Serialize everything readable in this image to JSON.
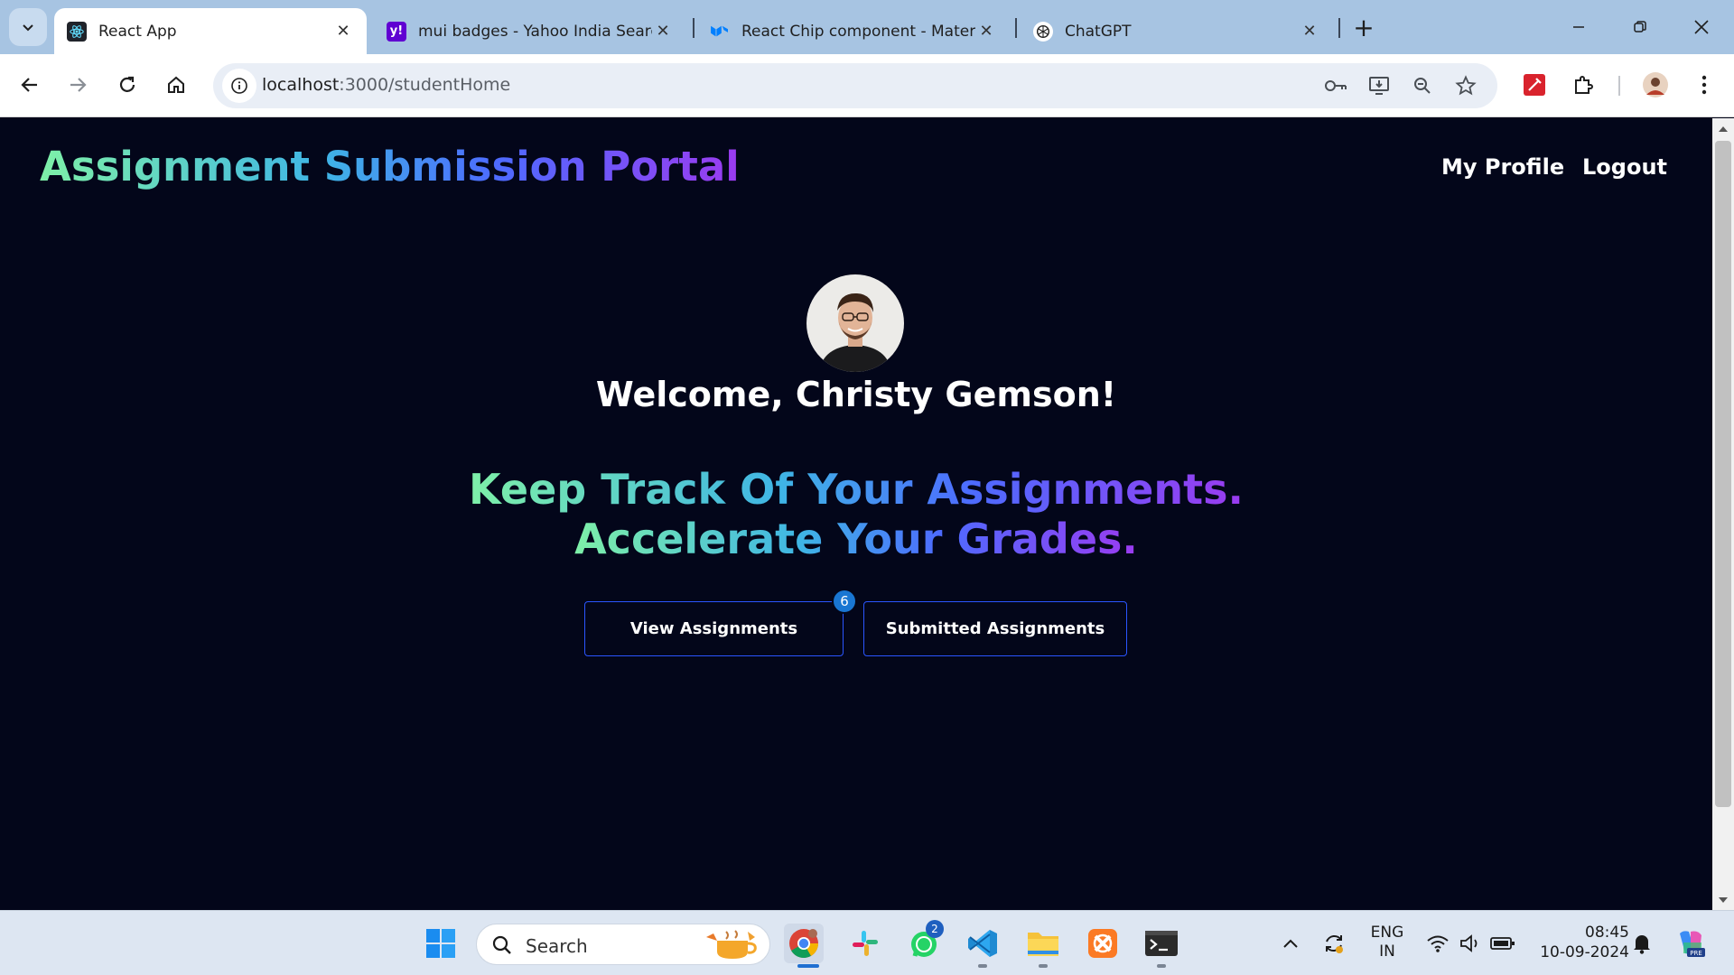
{
  "browser": {
    "tabs": [
      {
        "title": "React App",
        "active": true
      },
      {
        "title": "mui badges - Yahoo India Searc",
        "active": false
      },
      {
        "title": "React Chip component - Materi",
        "active": false
      },
      {
        "title": "ChatGPT",
        "active": false
      }
    ],
    "url_host": "localhost",
    "url_rest": ":3000/studentHome"
  },
  "page": {
    "brand": "Assignment Submission Portal",
    "nav": {
      "profile": "My Profile",
      "logout": "Logout"
    },
    "welcome": "Welcome, Christy Gemson!",
    "tagline_line1": "Keep Track Of Your Assignments.",
    "tagline_line2": "Accelerate Your Grades.",
    "buttons": {
      "view": "View Assignments",
      "submitted": "Submitted Assignments"
    },
    "badge_count": "6"
  },
  "taskbar": {
    "search_label": "Search",
    "whatsapp_badge": "2",
    "lang_top": "ENG",
    "lang_bottom": "IN",
    "time": "08:45",
    "date": "10-09-2024"
  },
  "colors": {
    "page_bg": "#03061a",
    "button_border": "#2a55ff",
    "badge": "#1976d2",
    "gradient": [
      "#7ef0a8",
      "#3fb5e5",
      "#4d6bff",
      "#9b3bf0"
    ]
  }
}
